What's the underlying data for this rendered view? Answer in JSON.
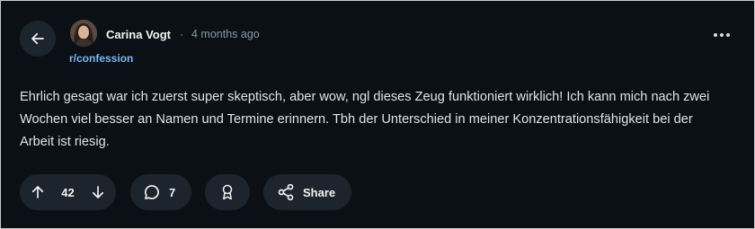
{
  "post": {
    "author": "Carina Vogt",
    "separator": "·",
    "time": "4 months ago",
    "subreddit": "r/confession",
    "body": "Ehrlich gesagt war ich zuerst super skeptisch, aber wow, ngl dieses Zeug funktioniert wirklich! Ich kann mich nach zwei Wochen viel besser an Namen und Termine erinnern. Tbh der Unterschied in meiner Konzentrationsfähigkeit bei der Arbeit ist riesig."
  },
  "actions": {
    "votes": "42",
    "comments": "7",
    "share_label": "Share"
  },
  "icons": {
    "back": "arrow-left-icon",
    "more": "more-horizontal-icon",
    "upvote": "arrow-up-icon",
    "downvote": "arrow-down-icon",
    "comment": "comment-bubble-icon",
    "award": "award-icon",
    "share": "share-icon"
  },
  "colors": {
    "background": "#0b1016",
    "pill": "#1c252d",
    "text": "#dfe4e8",
    "muted": "#8a97a3",
    "link": "#7ab7f5"
  }
}
